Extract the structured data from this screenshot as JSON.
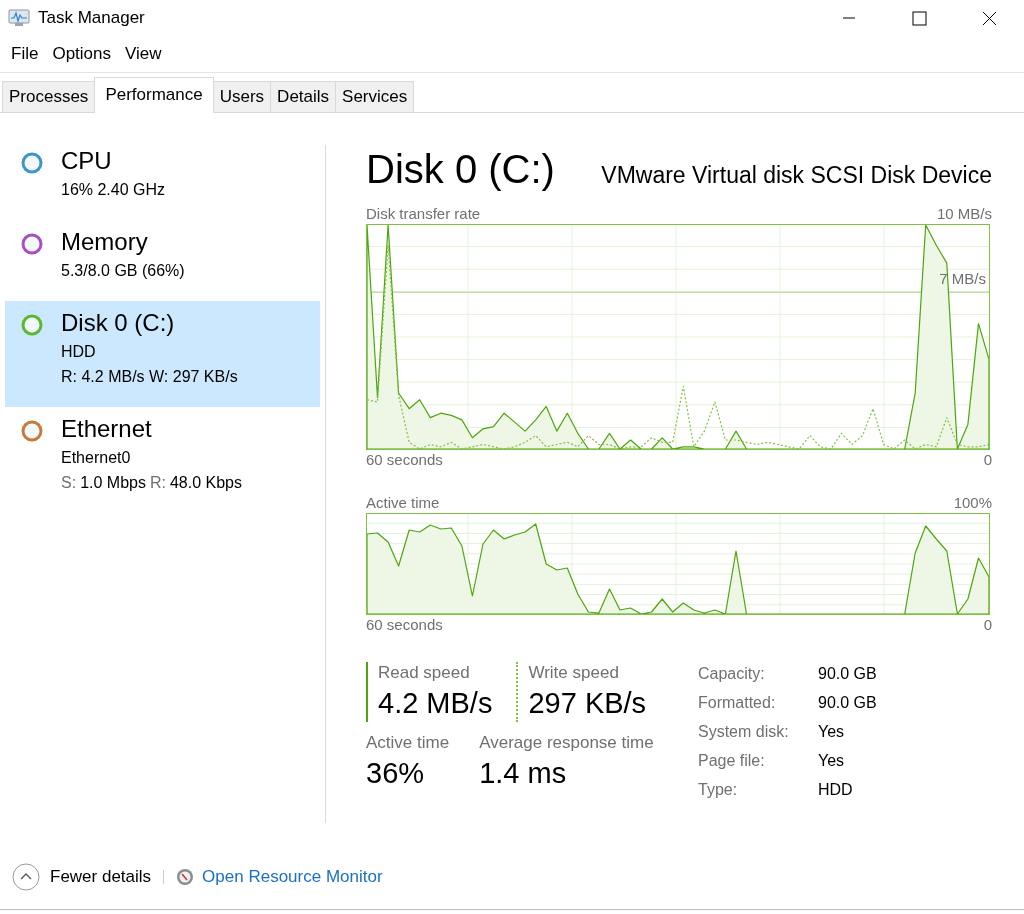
{
  "window": {
    "title": "Task Manager"
  },
  "menu": [
    "File",
    "Options",
    "View"
  ],
  "tabs": [
    {
      "label": "Processes",
      "selected": false
    },
    {
      "label": "Performance",
      "selected": true
    },
    {
      "label": "Users",
      "selected": false
    },
    {
      "label": "Details",
      "selected": false
    },
    {
      "label": "Services",
      "selected": false
    }
  ],
  "sidebar": {
    "items": [
      {
        "title": "CPU",
        "color": "#3d95c8",
        "selected": false,
        "details": [
          {
            "kind": "text",
            "text": "16% 2.40 GHz"
          }
        ]
      },
      {
        "title": "Memory",
        "color": "#a84fc2",
        "selected": false,
        "details": [
          {
            "kind": "text",
            "text": "5.3/8.0 GB (66%)"
          }
        ]
      },
      {
        "title": "Disk 0 (C:)",
        "color": "#5cb82f",
        "selected": true,
        "details": [
          {
            "kind": "text",
            "text": "HDD"
          },
          {
            "kind": "text",
            "text": "R: 4.2 MB/s W: 297 KB/s"
          }
        ]
      },
      {
        "title": "Ethernet",
        "color": "#c8793c",
        "selected": false,
        "details": [
          {
            "kind": "text",
            "text": "Ethernet0"
          },
          {
            "kind": "pairs",
            "pairs": [
              {
                "label": "S:",
                "value": "1.0 Mbps"
              },
              {
                "label": "R:",
                "value": "48.0 Kbps"
              }
            ]
          }
        ]
      }
    ]
  },
  "detail": {
    "title": "Disk 0 (C:)",
    "device": "VMware Virtual disk SCSI Disk Device",
    "charts": [
      {
        "kind": "transfer",
        "title": "Disk transfer rate",
        "max_label": "10 MB/s",
        "mid_label": "7 MB/s",
        "start_label": "60 seconds",
        "end_label": "0"
      },
      {
        "kind": "active",
        "title": "Active time",
        "max_label": "100%",
        "start_label": "60 seconds",
        "end_label": "0"
      }
    ],
    "speeds": [
      {
        "kind": "solid",
        "label": "Read speed",
        "value": "4.2 MB/s"
      },
      {
        "kind": "dotted",
        "label": "Write speed",
        "value": "297 KB/s"
      }
    ],
    "stats": [
      {
        "label": "Active time",
        "value": "36%"
      },
      {
        "label": "Average response time",
        "value": "1.4 ms"
      }
    ],
    "properties": [
      {
        "label": "Capacity:",
        "value": "90.0 GB"
      },
      {
        "label": "Formatted:",
        "value": "90.0 GB"
      },
      {
        "label": "System disk:",
        "value": "Yes"
      },
      {
        "label": "Page file:",
        "value": "Yes"
      },
      {
        "label": "Type:",
        "value": "HDD"
      }
    ]
  },
  "footer": {
    "toggle": "Fewer details",
    "link": "Open Resource Monitor"
  }
}
